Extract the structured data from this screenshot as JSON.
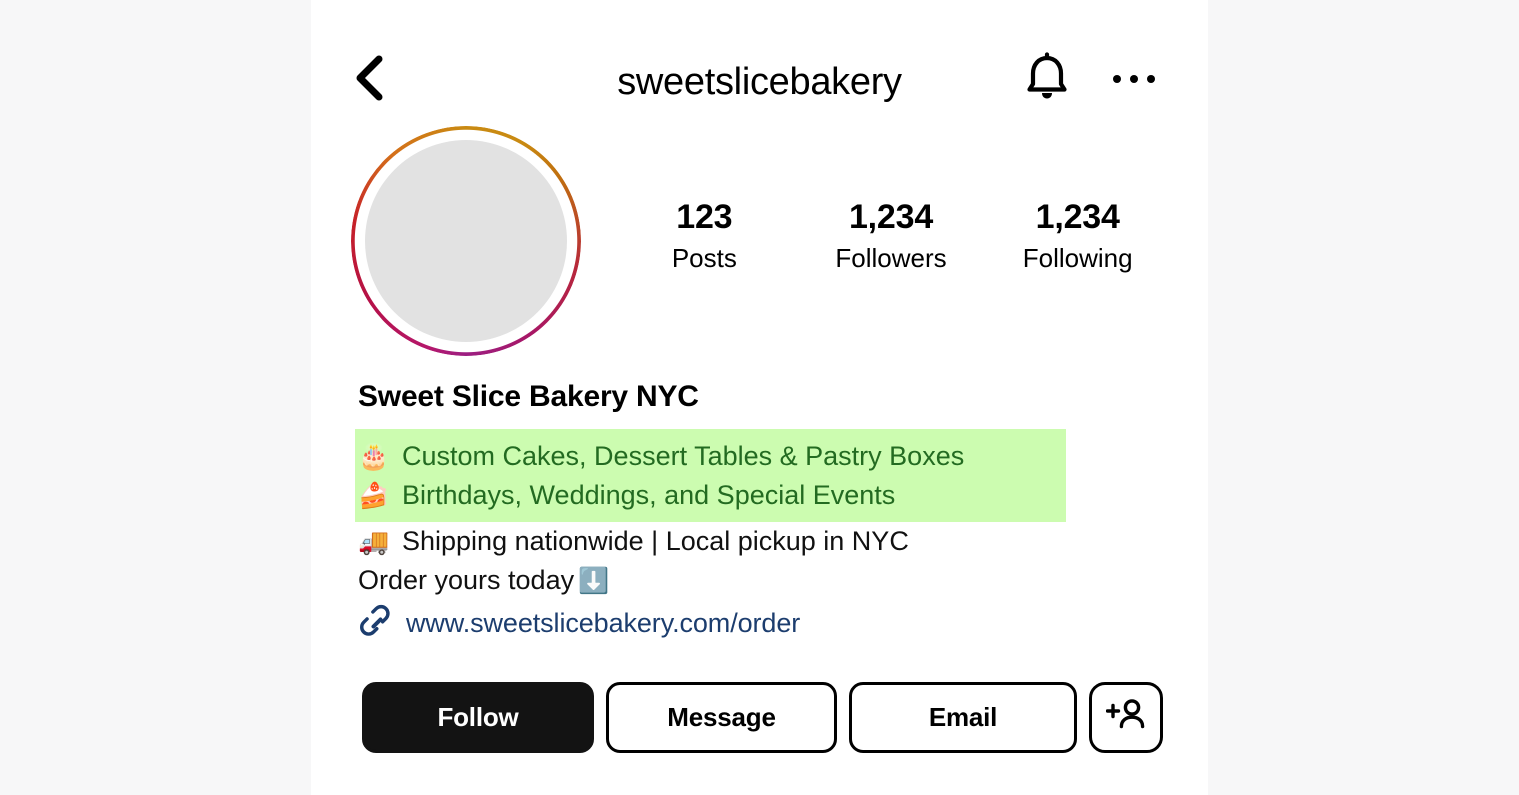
{
  "header": {
    "username": "sweetslicebakery",
    "back_icon": "chevron-left-icon",
    "notifications_icon": "bell-icon",
    "more_icon": "more-horizontal-icon"
  },
  "profile": {
    "avatar_placeholder_color": "#e2e2e2",
    "ring_colors": [
      "#b5176b",
      "#c62128",
      "#c98a12"
    ],
    "display_name": "Sweet Slice Bakery NYC"
  },
  "stats": [
    {
      "value": "123",
      "label": "Posts"
    },
    {
      "value": "1,234",
      "label": "Followers"
    },
    {
      "value": "1,234",
      "label": "Following"
    }
  ],
  "bio": {
    "highlight_color": "#ccfcb0",
    "highlight_text_color": "#236b21",
    "highlighted_lines": [
      {
        "emoji": "🎂",
        "text": "Custom Cakes, Dessert Tables & Pastry Boxes"
      },
      {
        "emoji": "🍰",
        "text": "Birthdays, Weddings, and Special Events"
      }
    ],
    "plain_lines": [
      {
        "emoji": "🚚",
        "text": "Shipping nationwide | Local pickup in NYC",
        "trailing_emoji": ""
      },
      {
        "emoji": "",
        "text": "Order yours today",
        "trailing_emoji": "⬇️"
      }
    ]
  },
  "link": {
    "icon": "link-icon",
    "url": "www.sweetslicebakery.com/order",
    "color": "#1c3d6e"
  },
  "actions": {
    "follow_label": "Follow",
    "message_label": "Message",
    "email_label": "Email",
    "add_person_icon": "user-plus-icon"
  }
}
